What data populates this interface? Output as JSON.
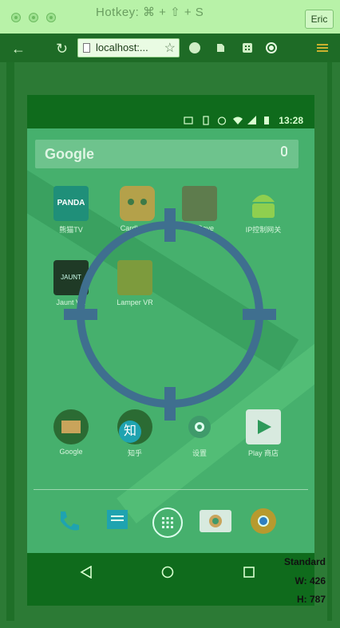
{
  "window": {
    "title": "Hotkey: ⌘ + ⇧ + S",
    "profile": "Eric"
  },
  "browser": {
    "url": "localhost:..."
  },
  "phone": {
    "status_time": "13:28",
    "search_logo": "Google",
    "apps_row1": [
      {
        "label": "熊猫TV",
        "icon": "panda-tv-icon",
        "icon_text": "PANDA"
      },
      {
        "label": "Cardboard",
        "icon": "cardboard-icon"
      },
      {
        "label": "VR Cave",
        "icon": "vr-cave-icon"
      },
      {
        "label": "IP控制网关",
        "icon": "android-icon"
      }
    ],
    "apps_row2": [
      {
        "label": "Jaunt VR",
        "icon": "jaunt-vr-icon",
        "icon_text": "JAUNT"
      },
      {
        "label": "Lamper VR",
        "icon": "lamper-vr-icon"
      }
    ],
    "apps_row3": [
      {
        "label": "Google",
        "icon": "gmail-icon"
      },
      {
        "label": "知乎",
        "icon": "zhihu-icon",
        "icon_text": "知"
      },
      {
        "label": "设置",
        "icon": "settings-icon"
      },
      {
        "label": "Play 商店",
        "icon": "play-store-icon"
      }
    ]
  },
  "overlay": {
    "mode": "Standard",
    "width_label": "W: 426",
    "height_label": "H: 787"
  },
  "colors": {
    "tint": "#2c7a35",
    "crosshair": "#3f6f8f"
  }
}
